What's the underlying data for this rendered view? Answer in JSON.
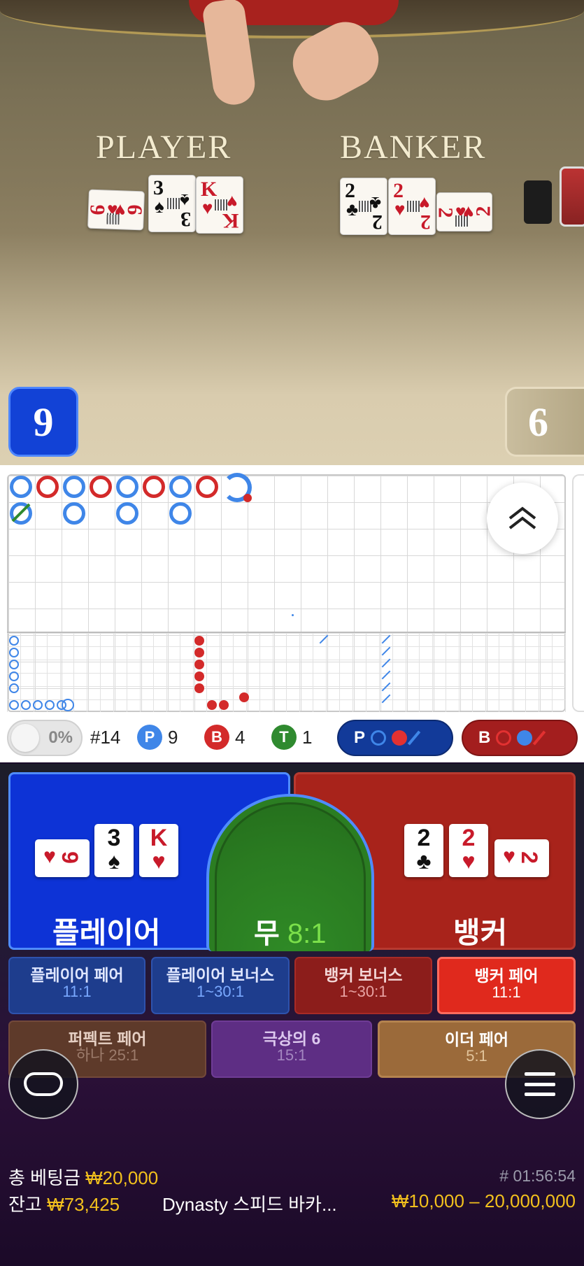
{
  "table": {
    "player_word": "PLAYER",
    "banker_word": "BANKER"
  },
  "video_cards": {
    "player": [
      {
        "rank": "9",
        "suit": "♥",
        "color": "red",
        "orient": "side"
      },
      {
        "rank": "3",
        "suit": "♠",
        "color": "black"
      },
      {
        "rank": "K",
        "suit": "♥",
        "color": "red"
      }
    ],
    "banker": [
      {
        "rank": "2",
        "suit": "♣",
        "color": "black"
      },
      {
        "rank": "2",
        "suit": "♥",
        "color": "red"
      },
      {
        "rank": "2",
        "suit": "♥",
        "color": "red",
        "orient": "side"
      }
    ]
  },
  "scores": {
    "player": "9",
    "banker": "6"
  },
  "stats": {
    "percent": "0%",
    "round": "#14",
    "p_label": "P",
    "p_count": "9",
    "b_label": "B",
    "b_count": "4",
    "t_label": "T",
    "t_count": "1"
  },
  "predict": {
    "player_label": "P",
    "banker_label": "B"
  },
  "colors": {
    "player": "#0d33d6",
    "banker": "#a8231b",
    "tie": "#2b7d22",
    "accent_gold": "#f2c01d"
  },
  "bets": {
    "player_label": "플레이어",
    "banker_label": "뱅커",
    "tie_label": "무",
    "tie_odds": "8:1",
    "player_cards": [
      {
        "rank": "9",
        "suit": "♥",
        "color": "red",
        "orient": "side"
      },
      {
        "rank": "3",
        "suit": "♠",
        "color": "black"
      },
      {
        "rank": "K",
        "suit": "♥",
        "color": "red"
      }
    ],
    "banker_cards": [
      {
        "rank": "2",
        "suit": "♣",
        "color": "black"
      },
      {
        "rank": "2",
        "suit": "♥",
        "color": "red"
      },
      {
        "rank": "2",
        "suit": "♥",
        "color": "red",
        "orient": "side"
      }
    ]
  },
  "side_bets": [
    {
      "name": "플레이어 페어",
      "odds": "11:1"
    },
    {
      "name": "플레이어 보너스",
      "odds": "1~30:1"
    },
    {
      "name": "뱅커 보너스",
      "odds": "1~30:1"
    },
    {
      "name": "뱅커 페어",
      "odds": "11:1"
    },
    {
      "name": "퍼펙트 페어",
      "odds": "하나 25:1"
    },
    {
      "name": "극상의 6",
      "odds": "15:1"
    },
    {
      "name": "이더 페어",
      "odds": "5:1"
    }
  ],
  "icons": {
    "chat": "chat-icon",
    "menu": "menu-icon",
    "up": "double-chevron-up-icon"
  },
  "footer": {
    "total_label": "총 베팅금",
    "total_value": "₩20,000",
    "balance_label": "잔고",
    "balance_value": "₩73,425",
    "game_name": "Dynasty 스피드 바카...",
    "game_id": "# 01:56:54",
    "limits": "₩10,000 – 20,000,000"
  }
}
